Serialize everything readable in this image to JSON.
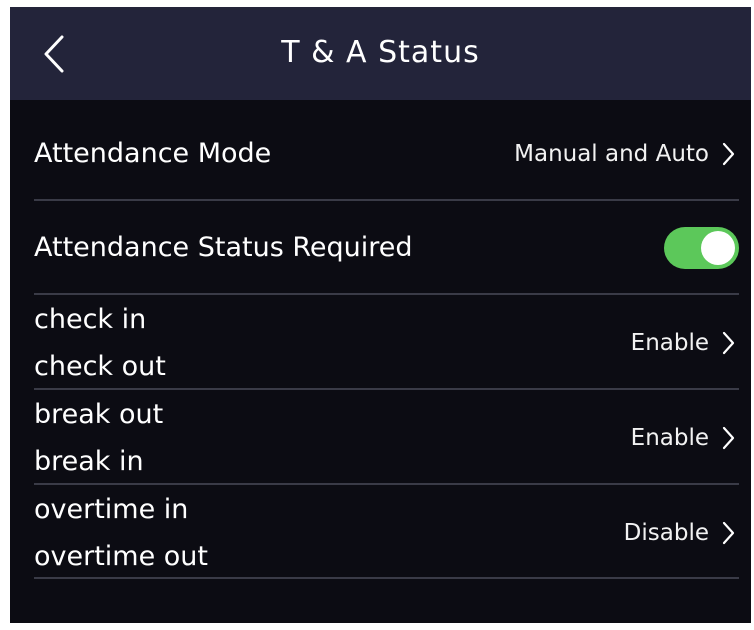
{
  "header": {
    "title": "T & A Status",
    "back_icon": "chevron-left-icon"
  },
  "settings": {
    "attendance_mode": {
      "label": "Attendance Mode",
      "value": "Manual and Auto"
    },
    "attendance_status_required": {
      "label": "Attendance Status Required",
      "enabled": true,
      "toggle_color": "#5cc85a"
    },
    "check": {
      "label_line1": "check in",
      "label_line2": "check out",
      "value": "Enable"
    },
    "break": {
      "label_line1": "break out",
      "label_line2": "break in",
      "value": "Enable"
    },
    "overtime": {
      "label_line1": "overtime in",
      "label_line2": "overtime out",
      "value": "Disable"
    }
  },
  "colors": {
    "background": "#0c0c13",
    "header": "#23243a",
    "divider": "#3a3b47",
    "text": "#ffffff"
  }
}
